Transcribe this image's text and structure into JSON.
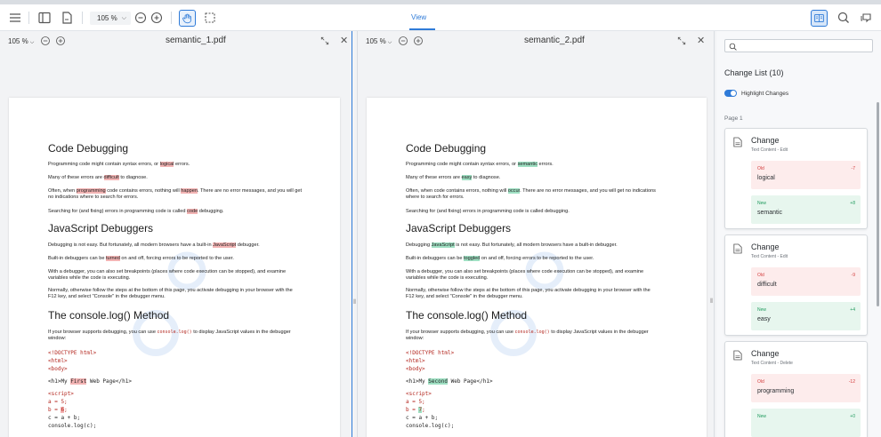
{
  "toolbar": {
    "zoom": "105 %",
    "view_tab": "View"
  },
  "left_pane": {
    "zoom": "105 %",
    "filename": "semantic_1.pdf",
    "doc": {
      "h1": "Code Debugging",
      "p1_pre": "Programming code might contain syntax errors, or ",
      "p1_hl": "logical",
      "p1_post": " errors.",
      "p2_pre": "Many of these errors are ",
      "p2_hl": "difficult",
      "p2_post": " to diagnose.",
      "p3_pre": "Often, when ",
      "p3_hl1": "programming",
      "p3_mid": " code contains errors, nothing will ",
      "p3_hl2": "happen",
      "p3_post": ". There are no error messages, and you will get no indications where to search for errors.",
      "p4_pre": "Searching for (and fixing) errors in programming code is called ",
      "p4_hl": "code",
      "p4_post": " debugging.",
      "h2": "JavaScript Debuggers",
      "p5_pre": "Debugging is not easy. But fortunately, all modern browsers have a built-in ",
      "p5_hl": "JavaScript",
      "p5_post": " debugger.",
      "p6_pre": "Built-in debuggers can be ",
      "p6_hl": "turned",
      "p6_post": " on and off, forcing errors to be reported to the user.",
      "p7": "With a debugger, you can also set breakpoints (places where code execution can be stopped), and examine variables while the code is executing.",
      "p8": "Normally, otherwise follow the steps at the bottom of this page, you activate debugging in your browser with the F12 key, and select \"Console\" in the debugger menu.",
      "h3": "The console.log() Method",
      "p9_pre": "If your browser supports debugging, you can use ",
      "p9_code": "console.log()",
      "p9_post": " to display JavaScript values in the debugger window:",
      "c1": "<!DOCTYPE html>",
      "c2": "<html>",
      "c3": "<body>",
      "c4_pre": "<h1>My ",
      "c4_hl": "First",
      "c4_post": " Web Page</h1>",
      "c5": "<script>",
      "c6": "a = 5;",
      "c7_pre": "b = ",
      "c7_hl": "6",
      "c7_post": ";",
      "c8": "c = a + b;",
      "c9": "console.log(c);"
    }
  },
  "right_pane": {
    "zoom": "105 %",
    "filename": "semantic_2.pdf",
    "doc": {
      "h1": "Code Debugging",
      "p1_pre": "Programming code might contain syntax errors, or ",
      "p1_hl": "semantic",
      "p1_post": " errors.",
      "p2_pre": "Many of these errors are ",
      "p2_hl": "easy",
      "p2_post": " to diagnose.",
      "p3_pre": "Often, when code contains errors, nothing will ",
      "p3_hl": "occur",
      "p3_post": ". There are no error messages, and you will get no indications where to search for errors.",
      "p4": "Searching for (and fixing) errors in programming code is called debugging.",
      "h2": "JavaScript Debuggers",
      "p5_pre": "Debugging ",
      "p5_hl": "JavaScript",
      "p5_post": " is not easy. But fortunately, all modern browsers have a built-in debugger.",
      "p6_pre": "Built-in debuggers can be ",
      "p6_hl": "toggled",
      "p6_post": " on and off, forcing errors to be reported to the user.",
      "p7": "With a debugger, you can also set breakpoints (places where code execution can be stopped), and examine variables while the code is executing.",
      "p8": "Normally, otherwise follow the steps at the bottom of this page, you activate debugging in your browser with the F12 key, and select \"Console\" in the debugger menu.",
      "h3": "The console.log() Method",
      "p9_pre": "If your browser supports debugging, you can use ",
      "p9_code": "console.log()",
      "p9_post": " to display JavaScript values in the debugger window:",
      "c1": "<!DOCTYPE html>",
      "c2": "<html>",
      "c3": "<body>",
      "c4_pre": "<h1>My ",
      "c4_hl": "Second",
      "c4_post": " Web Page</h1>",
      "c5": "<script>",
      "c6": "a = 5;",
      "c7_pre": "b = ",
      "c7_hl": "7",
      "c7_post": ";",
      "c8": "c = a + b;",
      "c9": "console.log(c);"
    }
  },
  "sidebar": {
    "title": "Change List (10)",
    "highlight_label": "Highlight Changes",
    "page_label": "Page 1",
    "changes": [
      {
        "title": "Change",
        "sub": "Text Content - Edit",
        "old_label": "Old",
        "old_count": "-7",
        "old_value": "logical",
        "new_label": "New",
        "new_count": "+8",
        "new_value": "semantic"
      },
      {
        "title": "Change",
        "sub": "Text Content - Edit",
        "old_label": "Old",
        "old_count": "-9",
        "old_value": "difficult",
        "new_label": "New",
        "new_count": "+4",
        "new_value": "easy"
      },
      {
        "title": "Change",
        "sub": "Text Content - Delete",
        "old_label": "Old",
        "old_count": "-12",
        "old_value": "programming",
        "new_label": "New",
        "new_count": "+0",
        "new_value": ""
      }
    ]
  },
  "colors": {
    "accent": "#2f7bd8",
    "removed_highlight": "#f3b4b4",
    "added_highlight": "#9fe0c3"
  }
}
